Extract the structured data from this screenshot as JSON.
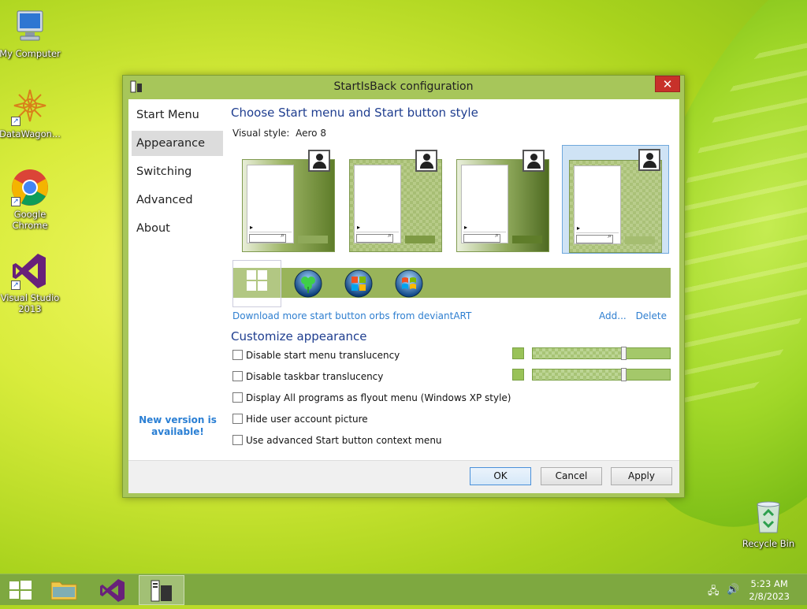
{
  "desktop": {
    "icons": [
      {
        "label": "My Computer",
        "icon": "computer-icon"
      },
      {
        "label": "DataWagon...",
        "icon": "datawagon-icon"
      },
      {
        "label": "Google Chrome",
        "icon": "chrome-icon"
      },
      {
        "label": "Visual Studio 2013",
        "icon": "visual-studio-icon"
      },
      {
        "label": "Recycle Bin",
        "icon": "recycle-bin-icon"
      }
    ]
  },
  "window": {
    "title": "StartIsBack configuration",
    "close_glyph": "✕",
    "sidebar": {
      "items": [
        "Start Menu",
        "Appearance",
        "Switching",
        "Advanced",
        "About"
      ],
      "selected": "Appearance",
      "new_version": "New version is available!"
    },
    "main": {
      "heading": "Choose Start menu and Start button style",
      "visual_style_label": "Visual style:",
      "visual_style_value": "Aero 8",
      "download_link": "Download more start button orbs from deviantART",
      "add_link": "Add...",
      "delete_link": "Delete",
      "customize_heading": "Customize appearance",
      "options": [
        {
          "label": "Disable start menu translucency",
          "checked": false
        },
        {
          "label": "Disable taskbar translucency",
          "checked": false
        },
        {
          "label": "Display All programs as flyout menu (Windows XP style)",
          "checked": false
        },
        {
          "label": "Hide user account picture",
          "checked": false
        },
        {
          "label": "Use advanced Start button context menu",
          "checked": false
        }
      ]
    },
    "buttons": {
      "ok": "OK",
      "cancel": "Cancel",
      "apply": "Apply"
    }
  },
  "colors": {
    "accent_green": "#99b45a",
    "link_blue": "#2f7fd0",
    "heading_blue": "#1e3d8f"
  },
  "taskbar": {
    "time": "5:23 AM",
    "date": "2/8/2023"
  }
}
